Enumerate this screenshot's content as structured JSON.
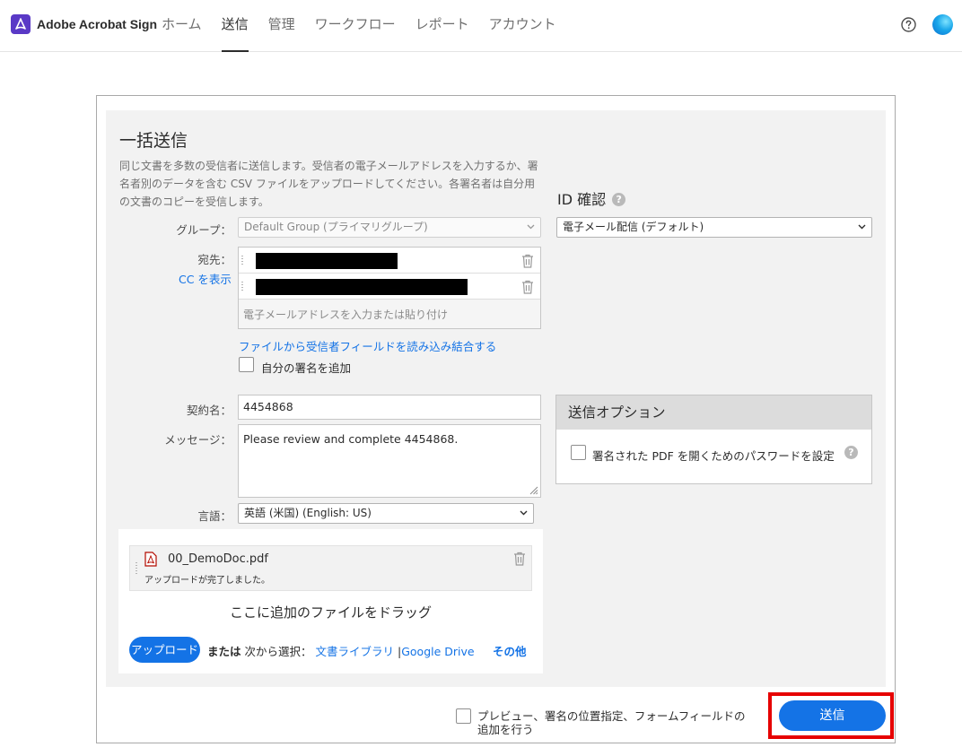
{
  "header": {
    "app_name": "Adobe Acrobat Sign",
    "tabs": [
      {
        "label": "ホーム",
        "active": false
      },
      {
        "label": "送信",
        "active": true
      },
      {
        "label": "管理",
        "active": false
      },
      {
        "label": "ワークフロー",
        "active": false
      },
      {
        "label": "レポート",
        "active": false
      },
      {
        "label": "アカウント",
        "active": false
      }
    ],
    "help_icon": "question-circle-icon",
    "avatar_icon": "user-avatar"
  },
  "form": {
    "title": "一括送信",
    "intro": "同じ文書を多数の受信者に送信します。受信者の電子メールアドレスを入力するか、署名者別のデータを含む CSV ファイルをアップロードしてください。各署名者は自分用の文書のコピーを受信します。",
    "group_label": "グループ：",
    "group_value": "Default Group (プライマリグループ)",
    "recipients_label": "宛先：",
    "show_cc": "CC を表示",
    "recipient_placeholder": "電子メールアドレスを入力または貼り付け",
    "import_link": "ファイルから受信者フィールドを読み込み結合する",
    "add_my_signature": "自分の署名を追加",
    "agreement_name_label": "契約名：",
    "agreement_name": "4454868",
    "message_label": "メッセージ：",
    "message": "Please review and complete 4454868.",
    "language_label": "言語：",
    "language_value": "英語 (米国) (English: US)"
  },
  "id_verification": {
    "title": "ID 確認",
    "value": "電子メール配信 (デフォルト)"
  },
  "send_options": {
    "title": "送信オプション",
    "password_option": "署名された PDF を開くためのパスワードを設定"
  },
  "files": {
    "file_name": "00_DemoDoc.pdf",
    "status": "アップロードが完了しました。",
    "drag_text": "ここに追加のファイルをドラッグ",
    "upload_button": "アップロード",
    "or_text": "または",
    "choose_from": "次から選択：",
    "library_link": "文書ライブラリ",
    "separator": "|",
    "gdrive_link": "Google Drive",
    "more_link": "その他"
  },
  "footer": {
    "preview_option": "プレビュー、署名の位置指定、フォームフィールドの追加を行う",
    "send_button": "送信"
  },
  "colors": {
    "accent": "#1473e6",
    "brand": "#5a39c6",
    "highlight": "#e60000"
  }
}
